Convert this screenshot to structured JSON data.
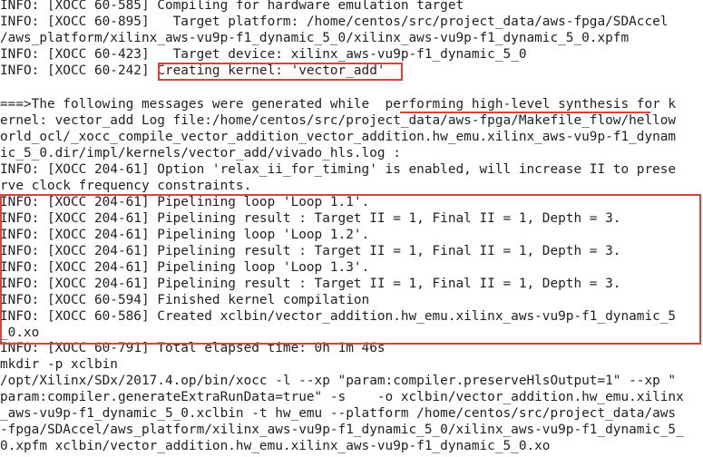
{
  "terminal": {
    "lines": [
      "INFO: [XOCC 60-585] Compiling for hardware emulation target",
      "INFO: [XOCC 60-895]   Target platform: /home/centos/src/project_data/aws-fpga/SDAccel",
      "/aws_platform/xilinx_aws-vu9p-f1_dynamic_5_0/xilinx_aws-vu9p-f1_dynamic_5_0.xpfm",
      "INFO: [XOCC 60-423]   Target device: xilinx_aws-vu9p-f1_dynamic_5_0",
      "INFO: [XOCC 60-242] Creating kernel: 'vector_add'",
      "",
      "===>The following messages were generated while  performing high-level synthesis for k",
      "ernel: vector_add Log file:/home/centos/src/project_data/aws-fpga/Makefile_flow/hellow",
      "orld_ocl/_xocc_compile_vector_addition_vector_addition.hw_emu.xilinx_aws-vu9p-f1_dynam",
      "ic_5_0.dir/impl/kernels/vector_add/vivado_hls.log :",
      "INFO: [XOCC 204-61] Option 'relax_ii_for_timing' is enabled, will increase II to prese",
      "rve clock frequency constraints.",
      "INFO: [XOCC 204-61] Pipelining loop 'Loop 1.1'.",
      "INFO: [XOCC 204-61] Pipelining result : Target II = 1, Final II = 1, Depth = 3.",
      "INFO: [XOCC 204-61] Pipelining loop 'Loop 1.2'.",
      "INFO: [XOCC 204-61] Pipelining result : Target II = 1, Final II = 1, Depth = 3.",
      "INFO: [XOCC 204-61] Pipelining loop 'Loop 1.3'.",
      "INFO: [XOCC 204-61] Pipelining result : Target II = 1, Final II = 1, Depth = 3.",
      "INFO: [XOCC 60-594] Finished kernel compilation",
      "INFO: [XOCC 60-586] Created xclbin/vector_addition.hw_emu.xilinx_aws-vu9p-f1_dynamic_5",
      "_0.xo",
      "INFO: [XOCC 60-791] Total elapsed time: 0h 1m 46s",
      "mkdir -p xclbin",
      "/opt/Xilinx/SDx/2017.4.op/bin/xocc -l --xp \"param:compiler.preserveHlsOutput=1\" --xp \"",
      "param:compiler.generateExtraRunData=true\" -s    -o xclbin/vector_addition.hw_emu.xilinx",
      "_aws-vu9p-f1_dynamic_5_0.xclbin -t hw_emu --platform /home/centos/src/project_data/aws",
      "-fpga/SDAccel/aws_platform/xilinx_aws-vu9p-f1_dynamic_5_0/xilinx_aws-vu9p-f1_dynamic_5_",
      "0.xpfm xclbin/vector_addition.hw_emu.xilinx_aws-vu9p-f1_dynamic_5_0.xo"
    ]
  },
  "colors": {
    "text": "#1f1f1f",
    "background": "#ffffff",
    "highlight": "#d9433a"
  }
}
